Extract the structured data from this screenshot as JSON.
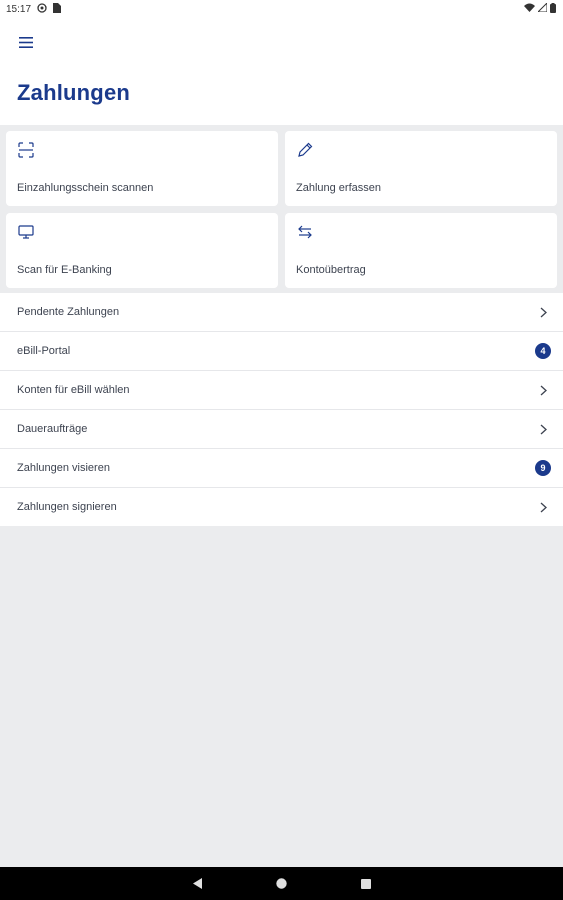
{
  "status_bar": {
    "time": "15:17",
    "icons_left": [
      "settings-circle-icon",
      "sim-card-icon"
    ],
    "icons_right": [
      "wifi-icon",
      "signal-icon",
      "battery-icon"
    ]
  },
  "header": {
    "menu_icon": "hamburger-menu-icon",
    "title": "Zahlungen"
  },
  "tiles": [
    {
      "icon": "scan-frame-icon",
      "label": "Einzahlungsschein scannen"
    },
    {
      "icon": "pencil-icon",
      "label": "Zahlung erfassen"
    },
    {
      "icon": "monitor-icon",
      "label": "Scan für E-Banking"
    },
    {
      "icon": "transfer-arrows-icon",
      "label": "Kontoübertrag"
    }
  ],
  "list": [
    {
      "label": "Pendente Zahlungen",
      "badge": null
    },
    {
      "label": "eBill-Portal",
      "badge": "4"
    },
    {
      "label": "Konten für eBill wählen",
      "badge": null
    },
    {
      "label": "Daueraufträge",
      "badge": null
    },
    {
      "label": "Zahlungen visieren",
      "badge": "9"
    },
    {
      "label": "Zahlungen signieren",
      "badge": null
    }
  ],
  "colors": {
    "accent": "#1b3a8c",
    "background": "#ebecee",
    "surface": "#ffffff"
  },
  "nav_bar": [
    "back-icon",
    "home-icon",
    "recents-icon"
  ]
}
